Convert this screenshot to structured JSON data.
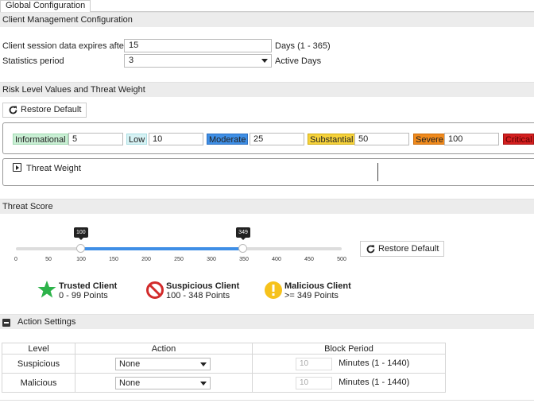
{
  "tab": {
    "label": "Global Configuration"
  },
  "client_mgmt": {
    "title": "Client Management Configuration",
    "expire_label": "Client session data expires after",
    "expire_value": "15",
    "expire_suffix": "Days (1 - 365)",
    "stats_label": "Statistics period",
    "stats_value": "3",
    "stats_suffix": "Active Days"
  },
  "risk": {
    "title": "Risk Level Values and Threat Weight",
    "restore_label": "Restore Default",
    "levels": [
      {
        "label": "Informational",
        "value": "5",
        "color": "#c9efd4"
      },
      {
        "label": "Low",
        "value": "10",
        "color": "#d6f2f4"
      },
      {
        "label": "Moderate",
        "value": "25",
        "color": "#3f8fe6"
      },
      {
        "label": "Substantial",
        "value": "50",
        "color": "#f6d23a"
      },
      {
        "label": "Severe",
        "value": "100",
        "color": "#f08a1c"
      },
      {
        "label": "Critical",
        "value": "",
        "color": "#d41f1f"
      }
    ],
    "threat_weight_label": "Threat Weight"
  },
  "threat_score": {
    "title": "Threat Score",
    "slider": {
      "min": 0,
      "max": 500,
      "low": 100,
      "high": 349,
      "low_label": "100",
      "high_label": "349",
      "ticks": [
        "0",
        "50",
        "100",
        "150",
        "200",
        "250",
        "300",
        "350",
        "400",
        "450",
        "500"
      ]
    },
    "restore_label": "Restore Default",
    "legend": [
      {
        "title": "Trusted Client",
        "sub": "0 - 99 Points",
        "icon": "star-icon",
        "color": "#2db34a"
      },
      {
        "title": "Suspicious Client",
        "sub": "100 - 348 Points",
        "icon": "prohibited-icon",
        "color": "#d22b2b"
      },
      {
        "title": "Malicious Client",
        "sub": ">= 349 Points",
        "icon": "warning-icon",
        "color": "#f6c21c"
      }
    ]
  },
  "action": {
    "title": "Action Settings",
    "headers": [
      "Level",
      "Action",
      "Block Period"
    ],
    "rows": [
      {
        "level": "Suspicious",
        "action": "None",
        "period": "10",
        "period_suffix": "Minutes (1 - 1440)"
      },
      {
        "level": "Malicious",
        "action": "None",
        "period": "10",
        "period_suffix": "Minutes (1 - 1440)"
      }
    ]
  }
}
